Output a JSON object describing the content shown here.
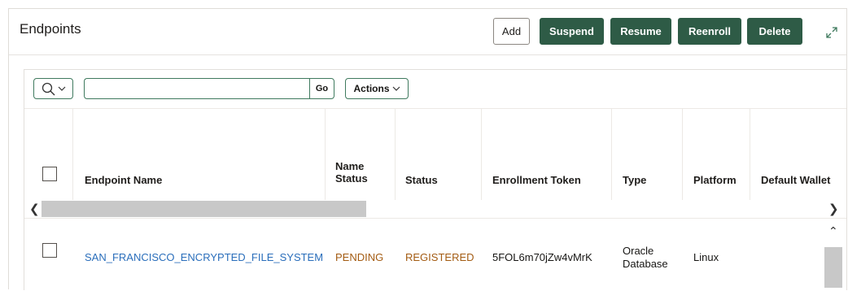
{
  "region": {
    "title": "Endpoints",
    "buttons": {
      "add": "Add",
      "suspend": "Suspend",
      "resume": "Resume",
      "reenroll": "Reenroll",
      "delete": "Delete"
    }
  },
  "toolbar": {
    "search_value": "",
    "go_label": "Go",
    "actions_label": "Actions"
  },
  "columns": {
    "endpoint_name": "Endpoint Name",
    "name_status_line1": "Name",
    "name_status_line2": "Status",
    "status": "Status",
    "enrollment_token": "Enrollment Token",
    "type": "Type",
    "platform": "Platform",
    "default_wallet": "Default Wallet"
  },
  "rows": [
    {
      "endpoint_name": "SAN_FRANCISCO_ENCRYPTED_FILE_SYSTEM",
      "name_status": "PENDING",
      "status": "REGISTERED",
      "enrollment_token": "5FOL6m70jZw4vMrK",
      "type_line1": "Oracle",
      "type_line2": "Database",
      "platform": "Linux",
      "default_wallet": ""
    }
  ],
  "colors": {
    "primary_button": "#2e5b46",
    "link": "#2a6ebb",
    "status_text": "#a35b12",
    "field_border": "#3f7a5e"
  },
  "icons": {
    "search": "search-icon",
    "chevron": "chevron-down-icon",
    "expand": "expand-icon"
  }
}
